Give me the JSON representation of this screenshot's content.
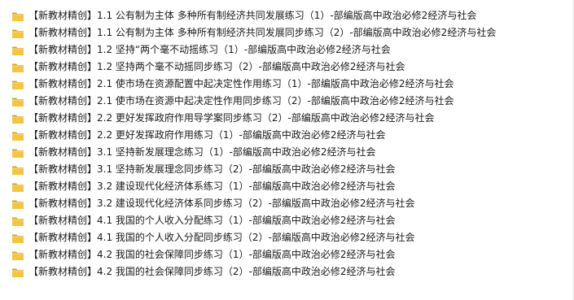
{
  "file_list": {
    "items": [
      {
        "name": "【新教材精创】1.1 公有制为主体 多种所有制经济共同发展练习（1）-部编版高中政治必修2经济与社会",
        "icon": "folder-icon"
      },
      {
        "name": "【新教材精创】1.1 公有制为主体 多种所有制经济共同发展同步练习（2）-部编版高中政治必修2经济与社会",
        "icon": "folder-icon"
      },
      {
        "name": "【新教材精创】1.2 坚持“两个毫不动摇练习（1）-部编版高中政治必修2经济与社会",
        "icon": "folder-icon"
      },
      {
        "name": "【新教材精创】1.2 坚持两个毫不动摇同步练习（2）-部编版高中政治必修2经济与社会",
        "icon": "folder-icon"
      },
      {
        "name": "【新教材精创】2.1 使市场在资源配置中起决定性作用练习（1）-部编版高中政治必修2经济与社会",
        "icon": "folder-icon"
      },
      {
        "name": "【新教材精创】2.1 使市场在资源中起决定性作用同步练习（2）-部编版高中政治必修2经济与社会",
        "icon": "folder-icon"
      },
      {
        "name": "【新教材精创】2.2 更好发挥政府作用导学案同步练习（2）-部编版高中政治必修2经济与社会",
        "icon": "folder-icon"
      },
      {
        "name": "【新教材精创】2.2 更好发挥政府作用练习（1）-部编版高中政治必修2经济与社会",
        "icon": "folder-icon"
      },
      {
        "name": "【新教材精创】3.1 坚持新发展理念练习（1）-部编版高中政治必修2经济与社会",
        "icon": "folder-icon"
      },
      {
        "name": "【新教材精创】3.1 坚持新发展理念同步练习（2）-部编版高中政治必修2经济与社会",
        "icon": "folder-icon"
      },
      {
        "name": "【新教材精创】3.2 建设现代化经济体系练习（1）-部编版高中政治必修2经济与社会",
        "icon": "folder-icon"
      },
      {
        "name": "【新教材精创】3.2 建设现代化经济体系同步练习（2）-部编版高中政治必修2经济与社会",
        "icon": "folder-icon"
      },
      {
        "name": "【新教材精创】4.1 我国的个人收入分配练习（1）-部编版高中政治必修2经济与社会",
        "icon": "folder-icon"
      },
      {
        "name": "【新教材精创】4.1 我国的个人收入分配同步练习（2）-部编版高中政治必修2经济与社会",
        "icon": "folder-icon"
      },
      {
        "name": "【新教材精创】4.2 我国的社会保障同步练习（1）-部编版高中政治必修2经济与社会",
        "icon": "folder-icon"
      },
      {
        "name": "【新教材精创】4.2 我国的社会保障同步练习（2）-部编版高中政治必修2经济与社会",
        "icon": "folder-icon"
      }
    ]
  },
  "colors": {
    "folder_front": "#f3c542",
    "folder_back": "#d9a521",
    "text": "#1a1a1a",
    "background": "#ffffff"
  }
}
